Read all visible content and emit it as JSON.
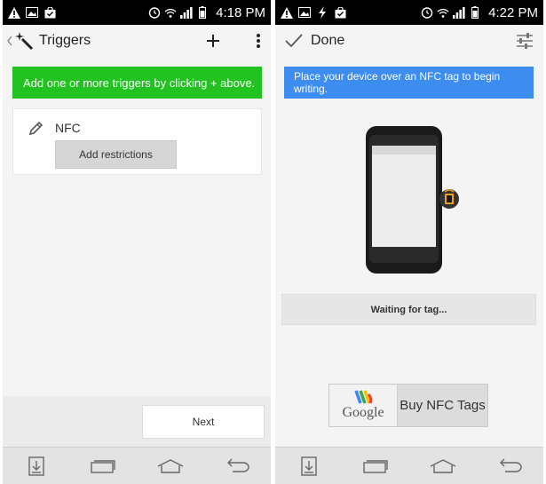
{
  "colors": {
    "green_banner": "#22c321",
    "blue_banner": "#3d8cf0",
    "statusbar": "#000000",
    "background": "#f4f4f4"
  },
  "left_screen": {
    "status": {
      "time": "4:18 PM"
    },
    "actionbar": {
      "title": "Triggers",
      "back_icon": "back-chevron-icon",
      "app_icon": "magic-wand-icon",
      "add_icon": "plus-icon",
      "menu_icon": "overflow-menu-icon"
    },
    "banner": "Add one or more triggers by clicking + above.",
    "trigger": {
      "name": "NFC",
      "icon": "pencil-icon",
      "button": "Add restrictions"
    },
    "next_button": "Next"
  },
  "right_screen": {
    "status": {
      "time": "4:22 PM"
    },
    "actionbar": {
      "title": "Done",
      "done_icon": "checkmark-icon",
      "settings_icon": "sliders-icon"
    },
    "banner": "Place your device over an NFC tag to begin writing.",
    "waiting": "Waiting for tag...",
    "buy": {
      "logo_text": "Google",
      "label": "Buy NFC Tags"
    }
  }
}
